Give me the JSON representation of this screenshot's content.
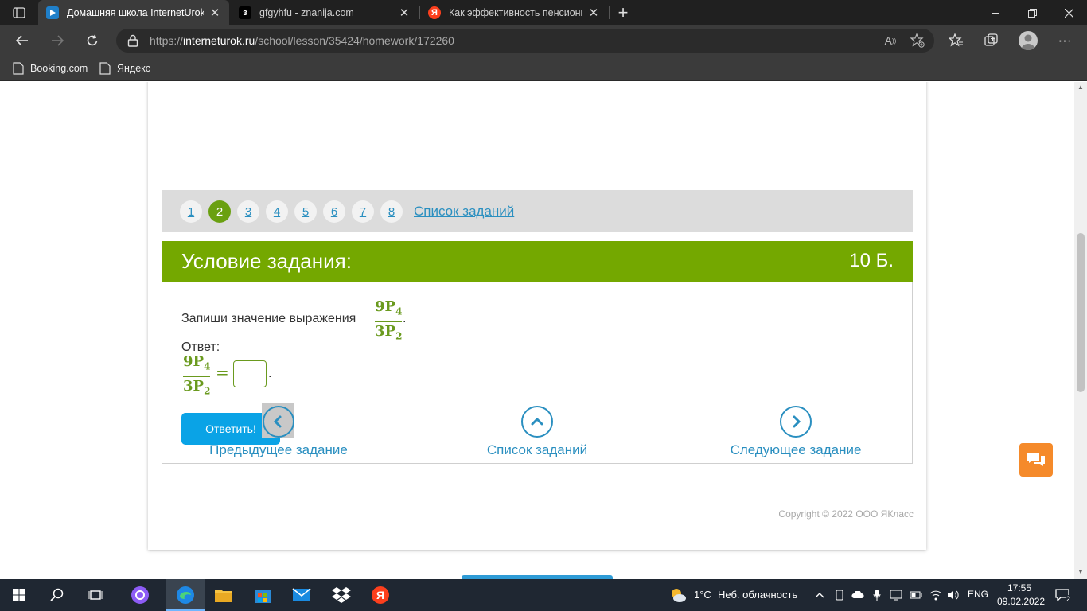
{
  "tabs": [
    {
      "title": "Домашняя школа InternetUrok.r",
      "favicon": "interneturok-icon",
      "active": true
    },
    {
      "title": "gfgyhfu - znanija.com",
      "favicon": "znanija-icon",
      "active": false
    },
    {
      "title": "Как эффективность пенсионног",
      "favicon": "yandex-icon",
      "active": false
    }
  ],
  "address": {
    "scheme": "https://",
    "host": "interneturok.ru",
    "path": "/school/lesson/35424/homework/172260"
  },
  "bookmarks": [
    {
      "label": "Booking.com"
    },
    {
      "label": "Яндекс"
    }
  ],
  "task_nav": {
    "numbers": [
      "1",
      "2",
      "3",
      "4",
      "5",
      "6",
      "7",
      "8"
    ],
    "active_number": "2",
    "tasks_link": "Список заданий"
  },
  "task": {
    "header_title": "Условие задания:",
    "points": "10 Б.",
    "prompt": "Запиши значение выражения",
    "fraction": {
      "num": "9P",
      "num_sub": "4",
      "den": "3P",
      "den_sub": "2"
    },
    "answer_label": "Ответ:",
    "answer_value": "",
    "submit_label": "Ответить!"
  },
  "bottom_nav": {
    "prev": "Предыдущее задание",
    "list": "Список заданий",
    "next": "Следующее задание"
  },
  "copyright": "Copyright © 2022 ООО ЯКласс",
  "taskbar": {
    "weather_temp": "1°C",
    "weather_desc": "Неб. облачность",
    "lang": "ENG",
    "time": "17:55",
    "date": "09.02.2022",
    "notifications": "2"
  },
  "colors": {
    "accent_green": "#74a800",
    "link_blue": "#2a8fc0",
    "button_blue": "#0aa3e6",
    "chat_orange": "#f58a2a"
  }
}
